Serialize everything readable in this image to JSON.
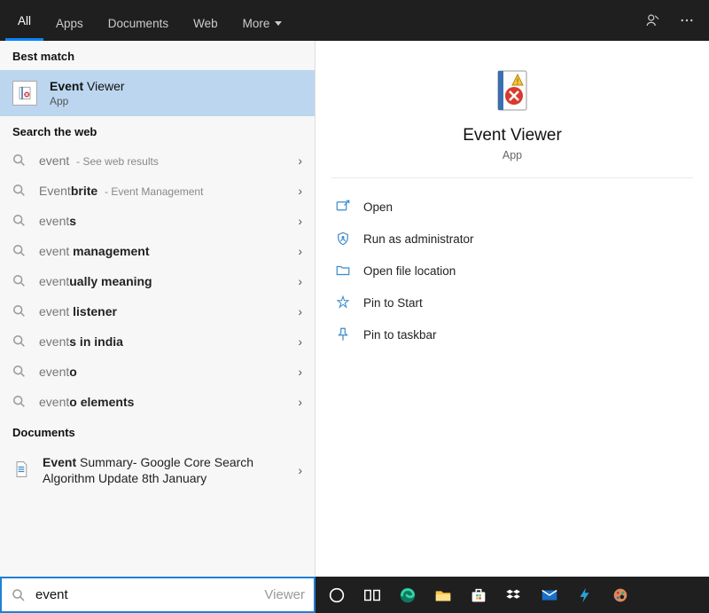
{
  "nav": {
    "tabs": [
      "All",
      "Apps",
      "Documents",
      "Web",
      "More"
    ],
    "active_index": 0
  },
  "left": {
    "best_match_header": "Best match",
    "selected": {
      "title_bold": "Event",
      "title_rest": " Viewer",
      "subtitle": "App"
    },
    "web_header": "Search the web",
    "web_items": [
      {
        "pre": "event",
        "bold": "",
        "post": "",
        "hint": "See web results"
      },
      {
        "pre": "Event",
        "bold": "brite",
        "post": "",
        "hint": "Event Management"
      },
      {
        "pre": "event",
        "bold": "s",
        "post": "",
        "hint": ""
      },
      {
        "pre": "event ",
        "bold": "management",
        "post": "",
        "hint": ""
      },
      {
        "pre": "event",
        "bold": "ually meaning",
        "post": "",
        "hint": ""
      },
      {
        "pre": "event ",
        "bold": "listener",
        "post": "",
        "hint": ""
      },
      {
        "pre": "event",
        "bold": "s in india",
        "post": "",
        "hint": ""
      },
      {
        "pre": "event",
        "bold": "o",
        "post": "",
        "hint": ""
      },
      {
        "pre": "event",
        "bold": "o elements",
        "post": "",
        "hint": ""
      }
    ],
    "docs_header": "Documents",
    "doc_item": {
      "bold": "Event",
      "rest": " Summary- Google Core Search Algorithm Update 8th January"
    }
  },
  "right": {
    "title": "Event Viewer",
    "subtitle": "App",
    "actions": [
      {
        "icon": "open-icon",
        "label": "Open"
      },
      {
        "icon": "admin-icon",
        "label": "Run as administrator"
      },
      {
        "icon": "folder-icon",
        "label": "Open file location"
      },
      {
        "icon": "pin-start-icon",
        "label": "Pin to Start"
      },
      {
        "icon": "pin-taskbar-icon",
        "label": "Pin to taskbar"
      }
    ]
  },
  "search": {
    "typed": "event",
    "suggestion_suffix": " Viewer"
  },
  "taskbar_icons": [
    "cortana-icon",
    "taskview-icon",
    "edge-icon",
    "explorer-icon",
    "store-icon",
    "dropbox-icon",
    "mail-icon",
    "lightning-icon",
    "paint-icon"
  ]
}
